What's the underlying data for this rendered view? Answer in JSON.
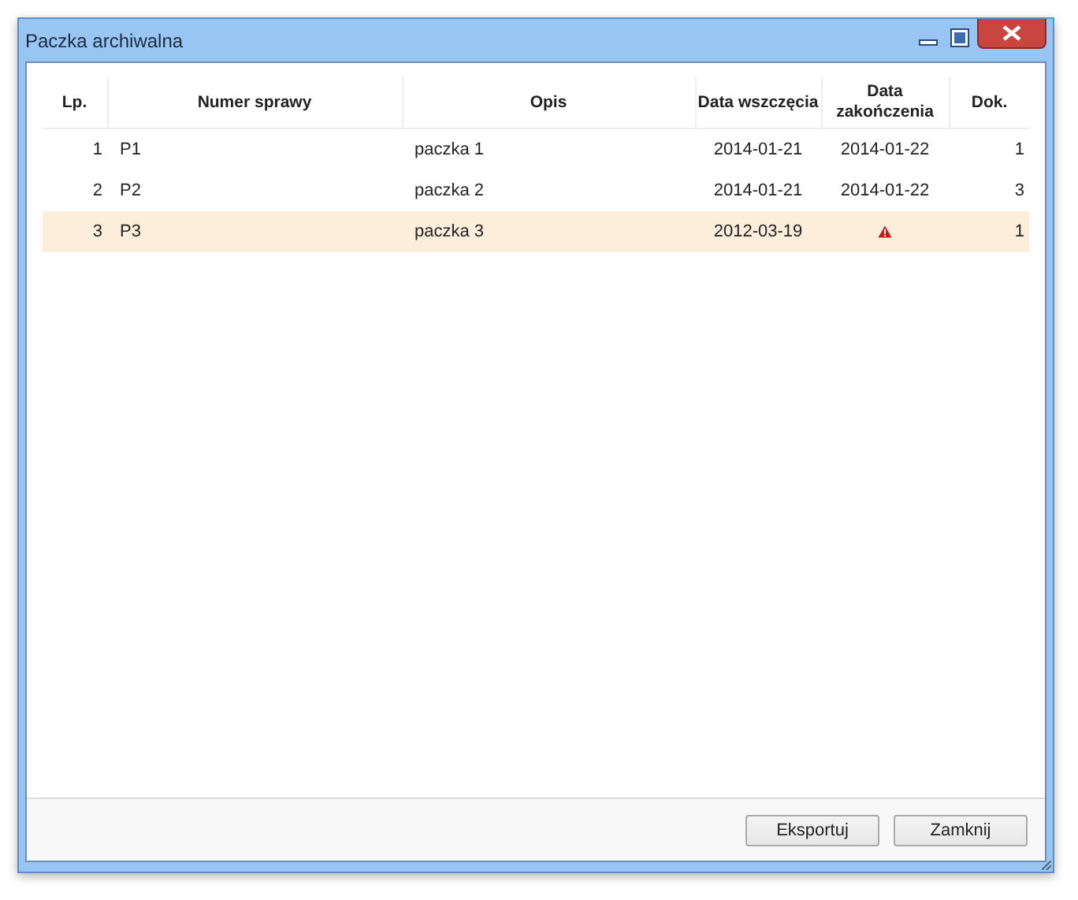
{
  "window": {
    "title": "Paczka archiwalna"
  },
  "table": {
    "columns": [
      "Lp.",
      "Numer sprawy",
      "Opis",
      "Data wszczęcia",
      "Data zakończenia",
      "Dok."
    ],
    "rows": [
      {
        "lp": "1",
        "number": "P1",
        "description": "paczka 1",
        "start": "2014-01-21",
        "end": "2014-01-22",
        "warning": false,
        "docs": "1",
        "selected": false
      },
      {
        "lp": "2",
        "number": "P2",
        "description": "paczka 2",
        "start": "2014-01-21",
        "end": "2014-01-22",
        "warning": false,
        "docs": "3",
        "selected": false
      },
      {
        "lp": "3",
        "number": "P3",
        "description": "paczka 3",
        "start": "2012-03-19",
        "warning": true,
        "docs": "1",
        "selected": true
      }
    ]
  },
  "buttons": [
    "Eksportuj",
    "Zamknij"
  ]
}
